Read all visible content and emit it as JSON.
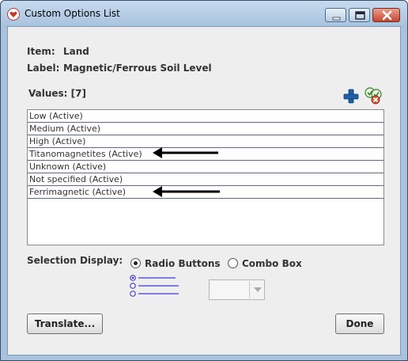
{
  "window": {
    "title": "Custom Options List"
  },
  "item": {
    "label": "Item:",
    "value": "Land"
  },
  "label_field": {
    "label": "Label:",
    "value": "Magnetic/Ferrous Soil Level"
  },
  "values": {
    "header": "Values: [7]",
    "items": [
      "Low (Active)",
      "Medium (Active)",
      "High (Active)",
      "Titanomagnetites (Active)",
      "Unknown (Active)",
      "Not specified (Active)",
      "Ferrimagnetic (Active)"
    ]
  },
  "selection_display": {
    "label": "Selection Display:",
    "radio_buttons_label": "Radio Buttons",
    "combo_box_label": "Combo Box",
    "selected": "Radio Buttons"
  },
  "buttons": {
    "translate": "Translate...",
    "done": "Done"
  },
  "icons": {
    "app": "heart-icon",
    "add": "plus-icon",
    "delete": "delete-icon",
    "arrow": "left-arrow-icon"
  },
  "colors": {
    "titlebar": "#b5cce4",
    "close_button": "#c8452f",
    "add_icon": "#1f5fa8",
    "preview_line": "#3b3bd4"
  }
}
